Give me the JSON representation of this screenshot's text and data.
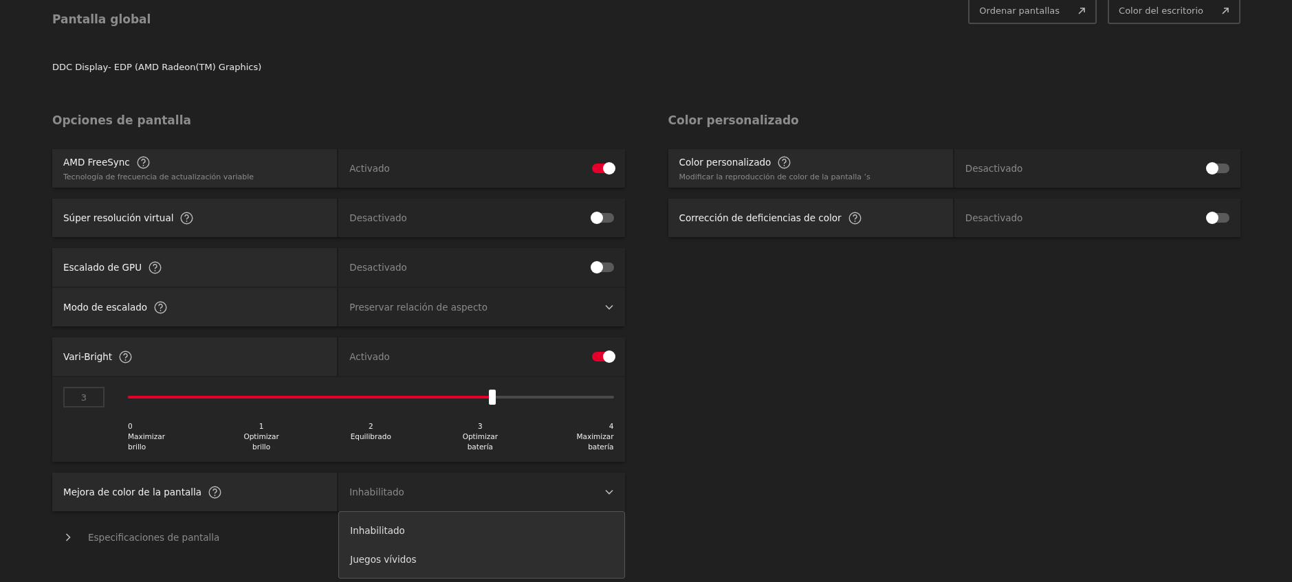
{
  "header": {
    "title": "Pantalla global",
    "buttons": [
      {
        "label": "Ordenar pantallas"
      },
      {
        "label": "Color del escritorio"
      }
    ]
  },
  "display_name": "DDC Display- EDP (AMD Radeon(TM) Graphics)",
  "display_options": {
    "heading": "Opciones de pantalla",
    "groups": [
      [
        {
          "kind": "toggle",
          "label": "AMD FreeSync",
          "description": "Tecnología de frecuencia de actualización variable",
          "status": "Activado",
          "on": true
        }
      ],
      [
        {
          "kind": "toggle",
          "label": "Súper resolución virtual",
          "status": "Desactivado",
          "on": false
        }
      ],
      [
        {
          "kind": "toggle",
          "label": "Escalado de GPU",
          "status": "Desactivado",
          "on": false
        },
        {
          "kind": "dropdown",
          "label": "Modo de escalado",
          "value": "Preservar relación de aspecto"
        }
      ],
      [
        {
          "kind": "toggle",
          "label": "Vari-Bright",
          "status": "Activado",
          "on": true
        },
        {
          "kind": "slider",
          "value": "3",
          "level": 0.75,
          "ticks": [
            {
              "number": "0",
              "label": "Maximizar brillo"
            },
            {
              "number": "1",
              "label": "Optimizar brillo"
            },
            {
              "number": "2",
              "label": "Equilibrado"
            },
            {
              "number": "3",
              "label": "Optimizar batería"
            },
            {
              "number": "4",
              "label": "Maximizar batería"
            }
          ]
        }
      ],
      [
        {
          "kind": "dropdown",
          "label": "Mejora de color de la pantalla",
          "value": "Inhabilitado",
          "expanded": true,
          "options": [
            "Inhabilitado",
            "Juegos vívidos"
          ]
        }
      ]
    ],
    "expander": {
      "label": "Especificaciones de pantalla",
      "expanded": false
    }
  },
  "custom_color": {
    "heading": "Color personalizado",
    "groups": [
      [
        {
          "kind": "toggle",
          "label": "Color personalizado",
          "description": "Modificar la reproducción de color de la pantalla ’s",
          "status": "Desactivado",
          "on": false
        }
      ],
      [
        {
          "kind": "toggle",
          "label": "Corrección de deficiencias de color",
          "status": "Desactivado",
          "on": false
        }
      ]
    ]
  }
}
